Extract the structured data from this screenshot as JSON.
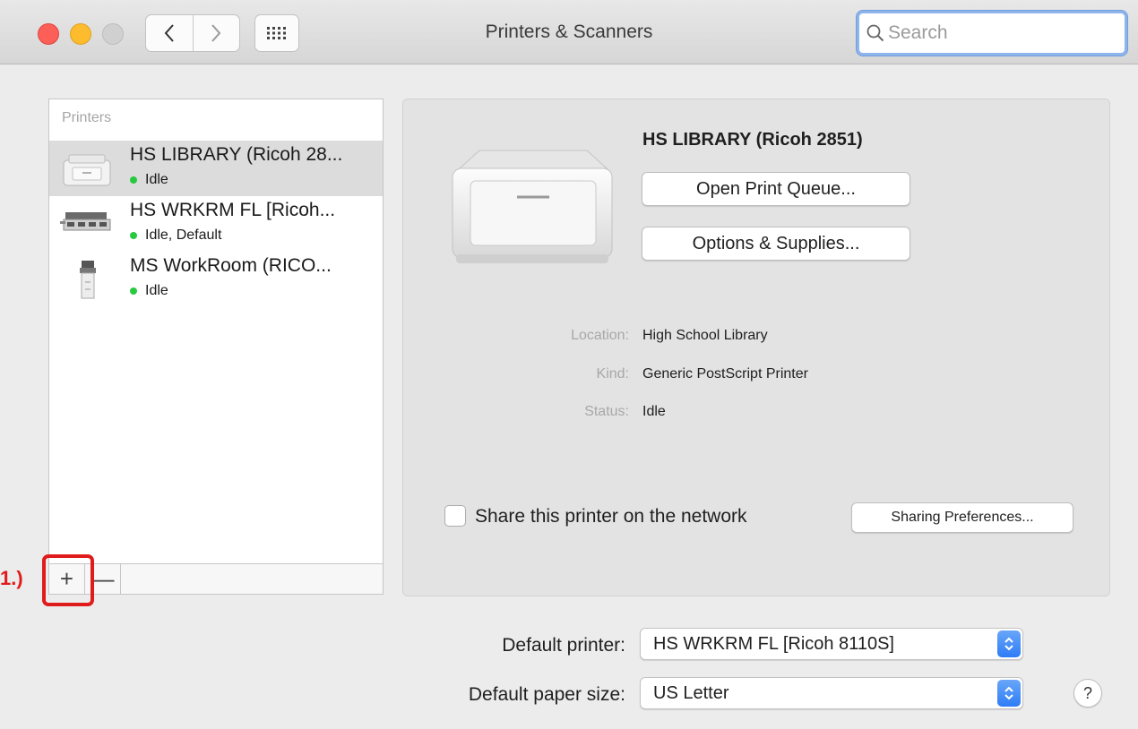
{
  "window": {
    "title": "Printers & Scanners",
    "search_placeholder": "Search"
  },
  "printer_list": {
    "header": "Printers",
    "printers": [
      {
        "name": "HS LIBRARY (Ricoh 28...",
        "status": "Idle",
        "selected": true
      },
      {
        "name": "HS WRKRM FL  [Ricoh...",
        "status": "Idle, Default",
        "selected": false
      },
      {
        "name": "MS WorkRoom (RICO...",
        "status": "Idle",
        "selected": false
      }
    ],
    "add_label": "+",
    "remove_label": "—"
  },
  "annotation": {
    "label": "1.)"
  },
  "detail": {
    "printer_name": "HS LIBRARY (Ricoh 2851)",
    "open_queue_label": "Open Print Queue...",
    "options_label": "Options & Supplies...",
    "location_label": "Location:",
    "location_value": "High School Library",
    "kind_label": "Kind:",
    "kind_value": "Generic PostScript Printer",
    "status_label": "Status:",
    "status_value": "Idle",
    "share_label": "Share this printer on the network",
    "share_checked": false,
    "sharing_prefs_label": "Sharing Preferences..."
  },
  "defaults": {
    "printer_label": "Default printer:",
    "printer_value": "HS WRKRM FL  [Ricoh 8110S]",
    "paper_label": "Default paper size:",
    "paper_value": "US Letter"
  },
  "help_label": "?",
  "colors": {
    "status_dot": "#27c93f",
    "annotation": "#e01b1b",
    "select_accent": "#2e7cf6"
  }
}
